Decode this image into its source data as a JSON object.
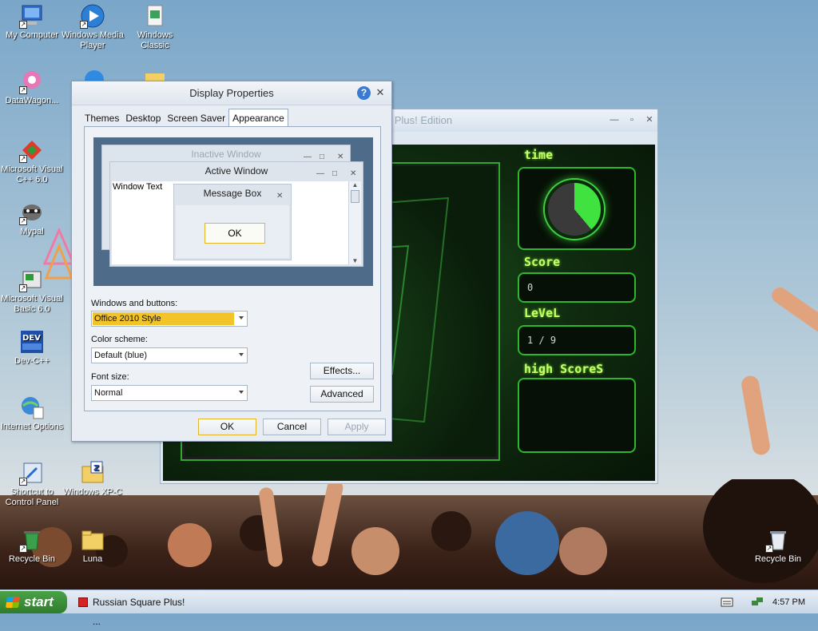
{
  "desktop": {
    "icons": [
      {
        "label": "My Computer"
      },
      {
        "label": "Windows Media Player"
      },
      {
        "label": "Windows Classic"
      },
      {
        "label": "DataWagon..."
      },
      {
        "label": "Microsoft Visual C++ 6.0"
      },
      {
        "label": "Mypal"
      },
      {
        "label": "Microsoft Visual Basic 6.0"
      },
      {
        "label": "Dev-C++"
      },
      {
        "label": "Internet Options"
      },
      {
        "label": "Shortcut to Control Panel"
      },
      {
        "label": "Windows XP-C"
      },
      {
        "label": "Recycle Bin"
      },
      {
        "label": "Luna"
      },
      {
        "label": "Recycle Bin"
      }
    ]
  },
  "game_window": {
    "title_fragment": "e Plus! Edition",
    "labels": {
      "time": "time",
      "score": "Score",
      "level": "LeVeL",
      "high_scores": "high ScoreS"
    },
    "score_value": "0",
    "level_value": "1 / 9"
  },
  "dialog": {
    "title": "Display Properties",
    "help_label": "?",
    "close_label": "✕",
    "tabs": [
      "Themes",
      "Desktop",
      "Screen Saver",
      "Appearance"
    ],
    "active_tab": "Appearance",
    "preview": {
      "inactive_title": "Inactive Window",
      "active_title": "Active Window",
      "window_text": "Window Text",
      "message_title": "Message Box",
      "message_ok": "OK"
    },
    "windows_buttons_label": "Windows and buttons:",
    "windows_buttons_value": "Office 2010 Style",
    "color_scheme_label": "Color scheme:",
    "color_scheme_value": "Default (blue)",
    "font_size_label": "Font size:",
    "font_size_value": "Normal",
    "effects_label": "Effects...",
    "advanced_label": "Advanced",
    "ok_label": "OK",
    "cancel_label": "Cancel",
    "apply_label": "Apply"
  },
  "taskbar": {
    "start_label": "start",
    "task_label": "Russian Square Plus! ...",
    "clock": "4:57 PM"
  },
  "colors": {
    "accent_yellow": "#f3c42a",
    "game_green": "#2bb82b"
  }
}
